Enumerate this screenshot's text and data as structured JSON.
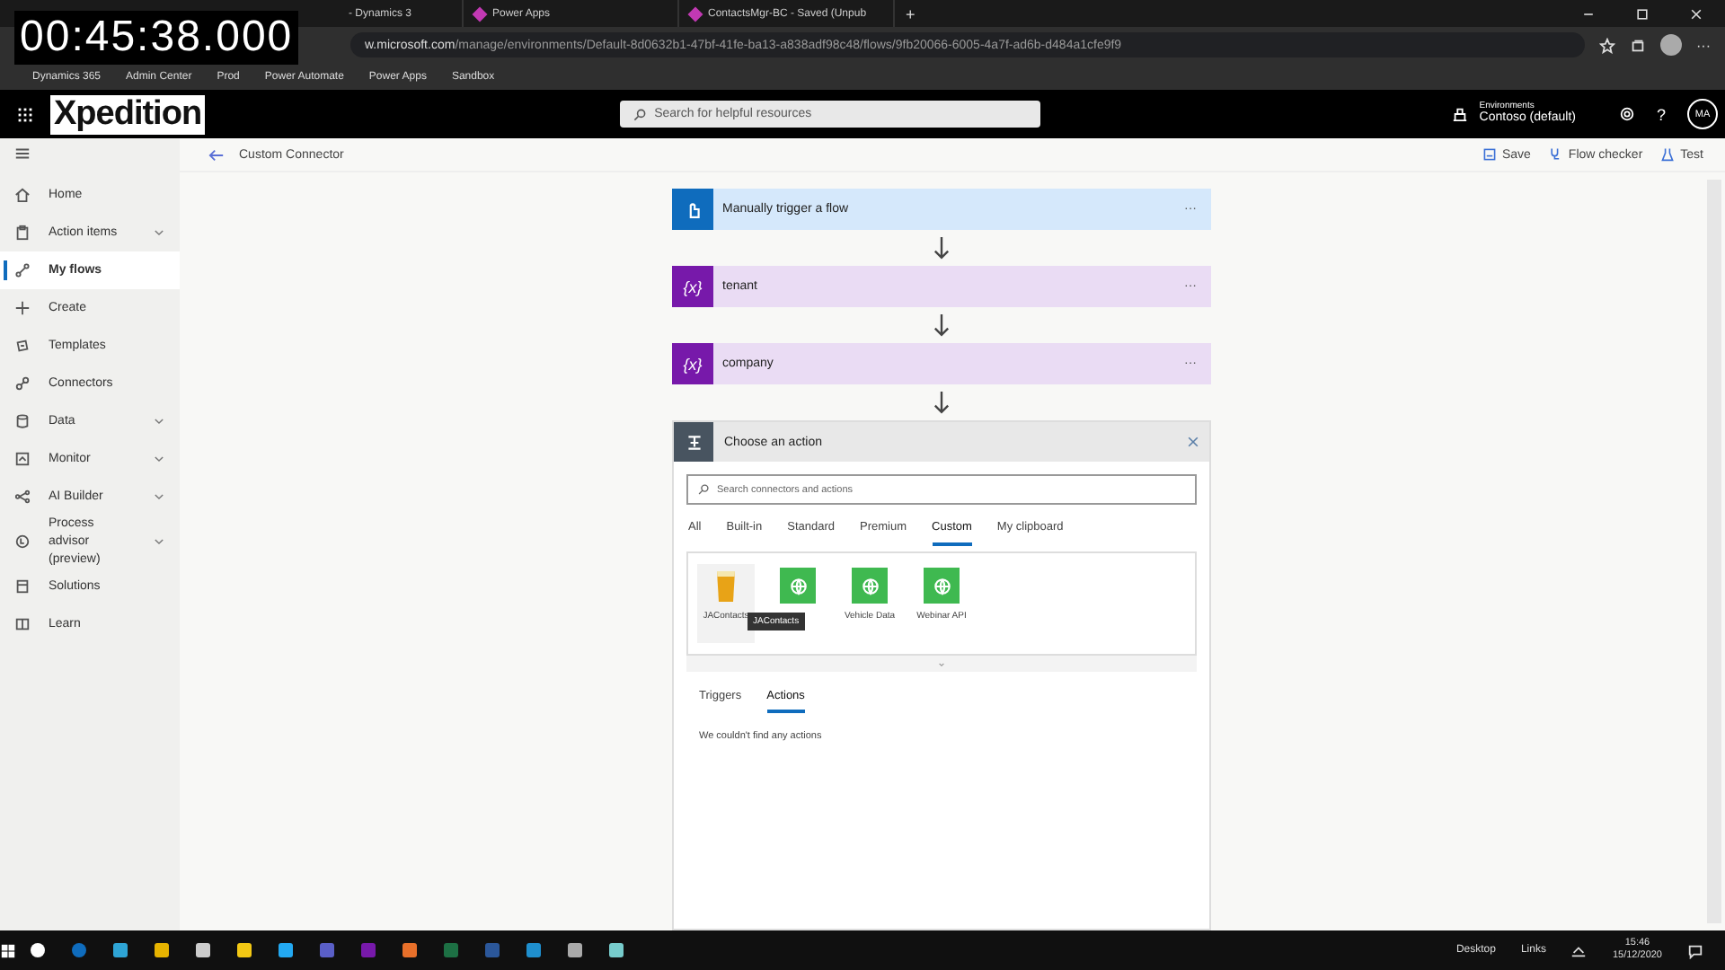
{
  "timecode": "00:45:38.000",
  "browser": {
    "tabs": [
      {
        "title": "- Dynamics 3",
        "selected": false
      },
      {
        "title": "Power Apps",
        "selected": false
      },
      {
        "title": "ContactsMgr-BC - Saved (Unpub",
        "selected": false
      }
    ],
    "new_tab": "+",
    "menu": "···",
    "url_domain": "w.microsoft.com",
    "url_path": "/manage/environments/Default-8d0632b1-47bf-41fe-ba13-a838adf98c48/flows/9fb20066-6005-4a7f-ad6b-d484a1cfe9f9",
    "bookmarks": [
      "Dynamics 365",
      "Admin Center",
      "Prod",
      "Power Automate",
      "Power Apps",
      "Sandbox"
    ]
  },
  "header": {
    "brand": "Xpedition",
    "search_placeholder": "Search for helpful resources",
    "environment_label": "Environments",
    "environment": "Contoso (default)",
    "avatar": "MA",
    "help": "?"
  },
  "toolbar": {
    "title": "Custom Connector",
    "actions": [
      "Save",
      "Flow checker",
      "Test"
    ]
  },
  "sidebar": {
    "items": [
      {
        "label": "Home",
        "expandable": false,
        "selected": false
      },
      {
        "label": "Action items",
        "expandable": true,
        "selected": false
      },
      {
        "label": "My flows",
        "expandable": false,
        "selected": true
      },
      {
        "label": "Create",
        "expandable": false,
        "selected": false
      },
      {
        "label": "Templates",
        "expandable": false,
        "selected": false
      },
      {
        "label": "Connectors",
        "expandable": false,
        "selected": false
      },
      {
        "label": "Data",
        "expandable": true,
        "selected": false
      },
      {
        "label": "Monitor",
        "expandable": true,
        "selected": false
      },
      {
        "label": "AI Builder",
        "expandable": true,
        "selected": false
      },
      {
        "label": "Process advisor (preview)",
        "expandable": true,
        "selected": false
      },
      {
        "label": "Solutions",
        "expandable": false,
        "selected": false
      },
      {
        "label": "Learn",
        "expandable": false,
        "selected": false
      }
    ]
  },
  "flow": {
    "steps": [
      {
        "kind": "trigger",
        "title": "Manually trigger a flow",
        "menu": "···"
      },
      {
        "kind": "variable",
        "title": "tenant",
        "menu": "···",
        "icon_text": "{x}"
      },
      {
        "kind": "variable",
        "title": "company",
        "menu": "···",
        "icon_text": "{x}"
      }
    ],
    "action_panel": {
      "title": "Choose an action",
      "search_placeholder": "Search connectors and actions",
      "categories": [
        {
          "label": "All",
          "selected": false
        },
        {
          "label": "Built-in",
          "selected": false
        },
        {
          "label": "Standard",
          "selected": false
        },
        {
          "label": "Premium",
          "selected": false
        },
        {
          "label": "Custom",
          "selected": true
        },
        {
          "label": "My clipboard",
          "selected": false
        }
      ],
      "connectors": [
        {
          "kind": "image",
          "label": "JAContacts"
        },
        {
          "kind": "globe",
          "tooltip": "JAContacts"
        },
        {
          "kind": "globe",
          "label": "Vehicle Data"
        },
        {
          "kind": "globe",
          "label": "Webinar API"
        }
      ],
      "subtabs": [
        {
          "label": "Triggers",
          "selected": false
        },
        {
          "label": "Actions",
          "selected": true
        }
      ],
      "message": "We couldn't find any actions"
    }
  },
  "taskbar": {
    "tray": [
      "Desktop",
      "Links"
    ],
    "time": "15:46",
    "date": "15/12/2020"
  }
}
